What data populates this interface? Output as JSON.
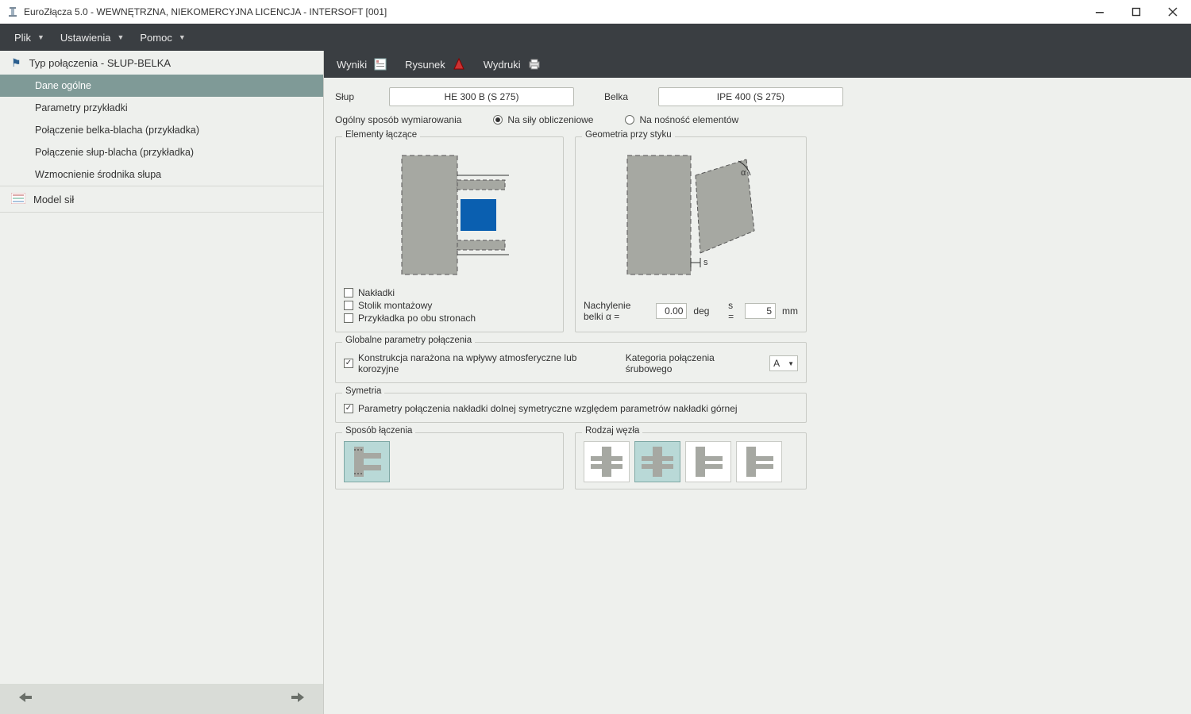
{
  "window": {
    "title": "EuroZłącza 5.0 - WEWNĘTRZNA, NIEKOMERCYJNA LICENCJA - INTERSOFT [001]"
  },
  "menu": {
    "plik": "Plik",
    "ustawienia": "Ustawienia",
    "pomoc": "Pomoc"
  },
  "toolbar": {
    "wyniki": "Wyniki",
    "rysunek": "Rysunek",
    "wydruki": "Wydruki"
  },
  "sidebar": {
    "section1_title": "Typ połączenia - SŁUP-BELKA",
    "items": [
      "Dane ogólne",
      "Parametry przykładki",
      "Połączenie belka-blacha (przykładka)",
      "Połączenie słup-blacha (przykładka)",
      "Wzmocnienie środnika słupa"
    ],
    "section2_title": "Model sił"
  },
  "profiles": {
    "slup_label": "Słup",
    "slup_value": "HE 300 B (S 275)",
    "belka_label": "Belka",
    "belka_value": "IPE 400 (S 275)"
  },
  "dimensioning": {
    "label": "Ogólny sposób wymiarowania",
    "opt1": "Na siły obliczeniowe",
    "opt2": "Na nośność elementów",
    "selected": "opt1"
  },
  "group_elements": {
    "title": "Elementy łączące",
    "chk_nakladki": "Nakładki",
    "chk_stolik": "Stolik montażowy",
    "chk_przykladka": "Przykładka po obu stronach"
  },
  "group_geometry": {
    "title": "Geometria przy styku",
    "alpha_sym": "α",
    "s_sym": "s",
    "nachylenie_label": "Nachylenie belki α =",
    "alpha_value": "0.00",
    "deg_unit": "deg",
    "s_label": "s =",
    "s_value": "5",
    "mm_unit": "mm"
  },
  "group_global": {
    "title": "Globalne parametry połączenia",
    "chk_korozja": "Konstrukcja narażona na wpływy atmosferyczne lub korozyjne",
    "kategoria_label": "Kategoria połączenia śrubowego",
    "kategoria_value": "A"
  },
  "group_symetria": {
    "title": "Symetria",
    "chk_sym": "Parametry połączenia nakładki dolnej symetryczne względem parametrów nakładki górnej"
  },
  "group_sposob": {
    "title": "Sposób łączenia"
  },
  "group_rodzaj": {
    "title": "Rodzaj węzła"
  }
}
